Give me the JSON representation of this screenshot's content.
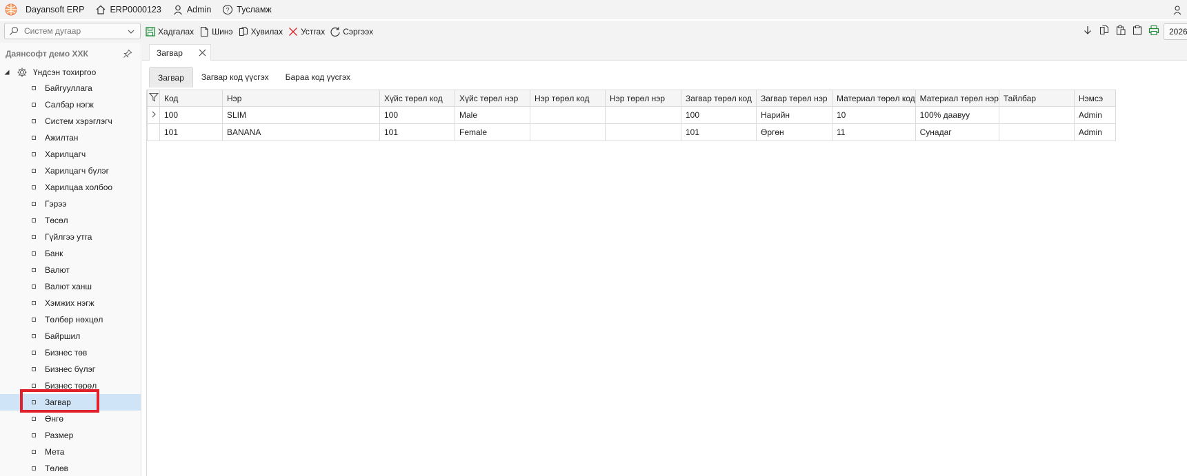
{
  "titlebar": {
    "app_name": "Dayansoft ERP",
    "home_label": "ERP0000123",
    "user_label": "Admin",
    "help_label": "Тусламж"
  },
  "toolbar": {
    "search_placeholder": "Систем дугаар",
    "buttons": [
      {
        "label": "Хадгалах",
        "icon": "save-icon"
      },
      {
        "label": "Шинэ",
        "icon": "new-document-icon"
      },
      {
        "label": "Хувилах",
        "icon": "copy-icon"
      },
      {
        "label": "Устгах",
        "icon": "delete-icon"
      },
      {
        "label": "Сэргээх",
        "icon": "refresh-icon"
      }
    ],
    "year": "2026"
  },
  "sidebar": {
    "company": "Даянсофт демо ХХК",
    "root_label": "Үндсэн тохиргоо",
    "items": [
      {
        "label": "Байгууллага"
      },
      {
        "label": "Салбар нэгж"
      },
      {
        "label": "Систем хэрэглэгч"
      },
      {
        "label": "Ажилтан"
      },
      {
        "label": "Харилцагч"
      },
      {
        "label": "Харилцагч бүлэг"
      },
      {
        "label": "Харилцаа холбоо"
      },
      {
        "label": "Гэрээ"
      },
      {
        "label": "Төсөл"
      },
      {
        "label": "Гүйлгээ утга"
      },
      {
        "label": "Банк"
      },
      {
        "label": "Валют"
      },
      {
        "label": "Валют ханш"
      },
      {
        "label": "Хэмжих нэгж"
      },
      {
        "label": "Төлбөр нөхцөл"
      },
      {
        "label": "Байршил"
      },
      {
        "label": "Бизнес төв"
      },
      {
        "label": "Бизнес бүлэг"
      },
      {
        "label": "Бизнес төрөл"
      },
      {
        "label": "Загвар"
      },
      {
        "label": "Өнгө"
      },
      {
        "label": "Размер"
      },
      {
        "label": "Мета"
      },
      {
        "label": "Төлөв"
      }
    ],
    "selected_index": 19
  },
  "document_tab": {
    "label": "Загвар"
  },
  "sub_tabs": [
    {
      "label": "Загвар"
    },
    {
      "label": "Загвар код үүсгэх"
    },
    {
      "label": "Бараа код үүсгэх"
    }
  ],
  "grid": {
    "columns": [
      "Код",
      "Нэр",
      "Хүйс төрөл код",
      "Хүйс төрөл нэр",
      "Нэр төрөл код",
      "Нэр төрөл нэр",
      "Загвар төрөл код",
      "Загвар төрөл нэр",
      "Материал төрөл код",
      "Материал төрөл нэр",
      "Тайлбар",
      "Нэмсэ"
    ],
    "rows": [
      [
        "100",
        "SLIM",
        "100",
        "Male",
        "",
        "",
        "100",
        "Нарийн",
        "10",
        "100% даавуу",
        "",
        "Admin"
      ],
      [
        "101",
        "BANANA",
        "101",
        "Female",
        "",
        "",
        "101",
        "Өргөн",
        "11",
        "Сунадаг",
        "",
        "Admin"
      ]
    ]
  }
}
